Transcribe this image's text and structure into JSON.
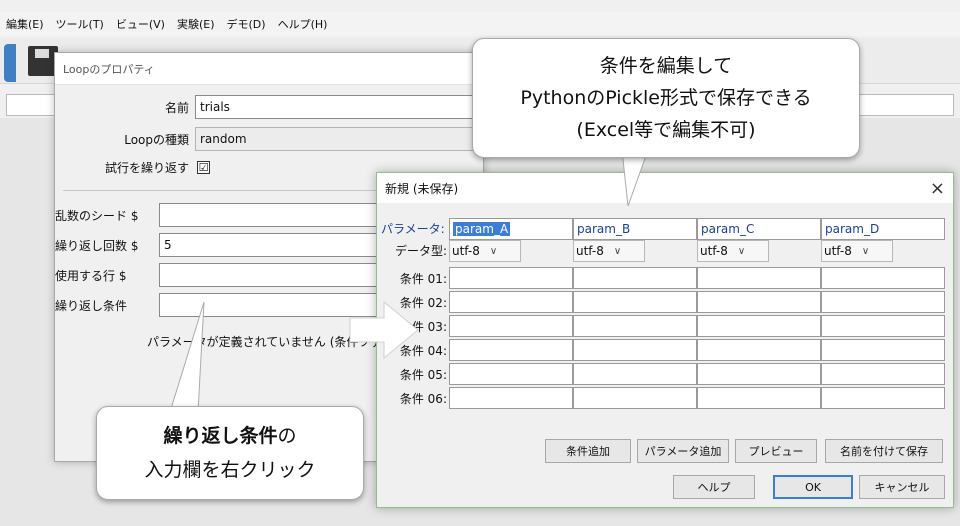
{
  "menubar": [
    "編集(E)",
    "ツール(T)",
    "ビュー(V)",
    "実験(E)",
    "デモ(D)",
    "ヘルプ(H)"
  ],
  "loop_dialog": {
    "title": "Loopのプロパティ",
    "name_label": "名前",
    "name_value": "trials",
    "type_label": "Loopの種類",
    "type_value": "random",
    "repeat_label": "試行を繰り返す",
    "repeat_checked": "☑",
    "seed_label": "乱数のシード $",
    "seed_value": "",
    "nreps_label": "繰り返し回数 $",
    "nreps_value": "5",
    "rows_label": "使用する行 $",
    "rows_value": "",
    "conditions_label": "繰り返し条件",
    "conditions_value": "",
    "no_params_msg": "パラメータが定義されていません (条件ファ"
  },
  "cond_dialog": {
    "title": "新規 (未保存)",
    "close": "×",
    "param_label": "パラメータ:",
    "dtype_label": "データ型:",
    "params": [
      "param_A",
      "param_B",
      "param_C",
      "param_D"
    ],
    "dtypes": [
      "utf-8",
      "utf-8",
      "utf-8",
      "utf-8"
    ],
    "rows": [
      "条件 01:",
      "条件 02:",
      "条件 03:",
      "条件 04:",
      "条件 05:",
      "条件 06:"
    ],
    "buttons": {
      "add_condition": "条件追加",
      "add_param": "パラメータ追加",
      "preview": "プレビュー",
      "save_as": "名前を付けて保存",
      "help": "ヘルプ",
      "ok": "OK",
      "cancel": "キャンセル"
    }
  },
  "callout_top": {
    "line1": "条件を編集して",
    "line2": "PythonのPickle形式で保存できる",
    "line3": "(Excel等で編集不可)"
  },
  "callout_bottom": {
    "line1_bold": "繰り返し条件",
    "line1_rest": "の",
    "line2": "入力欄を右クリック"
  },
  "icons": [
    "save-icon",
    "close-icon",
    "chevron-down-icon",
    "arrow-right-icon"
  ]
}
